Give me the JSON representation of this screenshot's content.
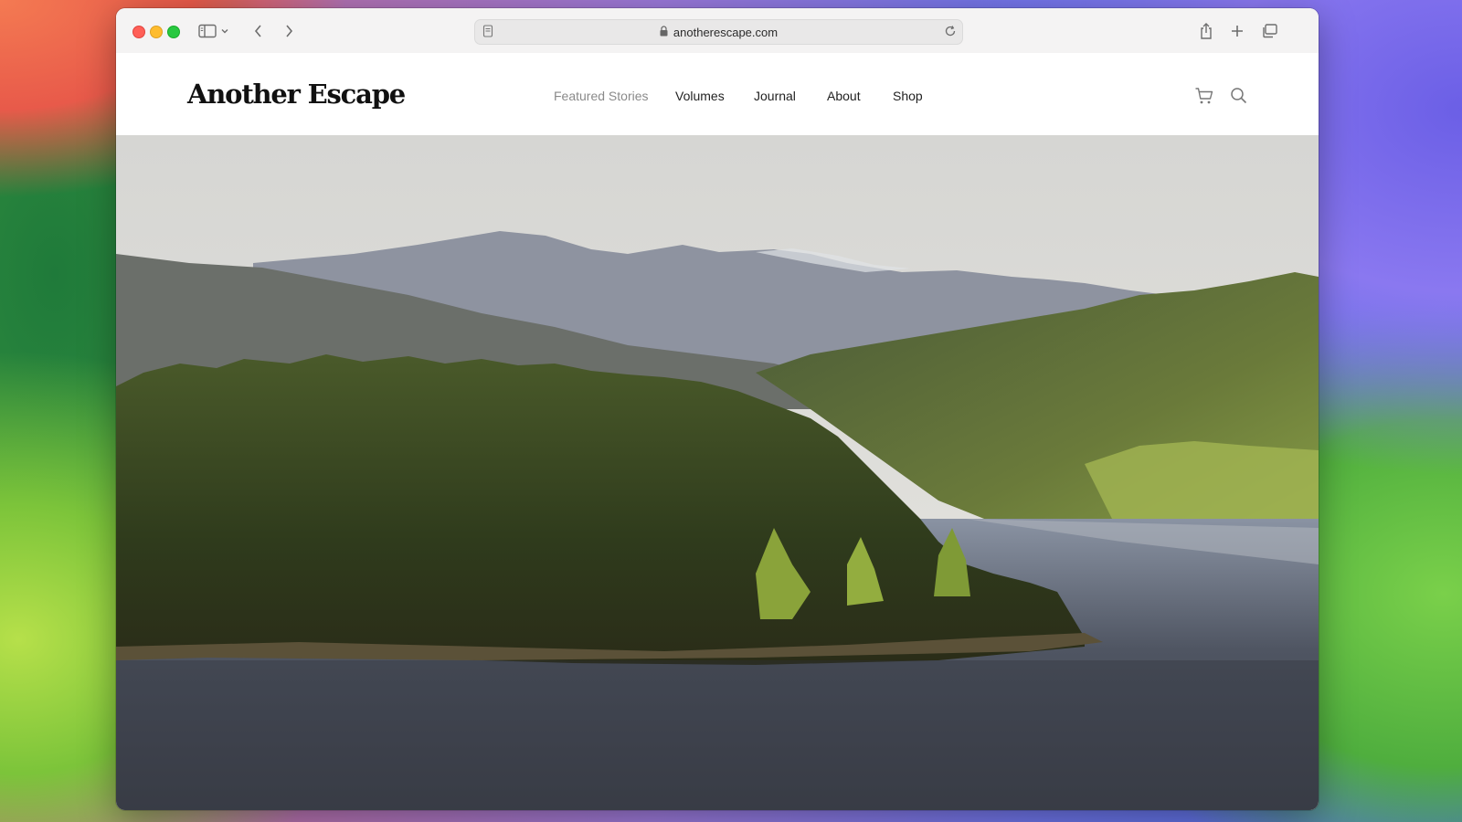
{
  "browser": {
    "url": "anotherescape.com",
    "icons": {
      "sidebar": "sidebar-icon",
      "sidebar_menu": "chevron-down-icon",
      "back": "chevron-left-icon",
      "forward": "chevron-right-icon",
      "page": "page-icon",
      "lock": "lock-icon",
      "reload": "reload-icon",
      "share": "share-icon",
      "new_tab": "plus-icon",
      "tabs": "tabs-overview-icon"
    }
  },
  "site": {
    "logo": "Another Escape",
    "nav": [
      "Featured Stories",
      "Volumes",
      "Journal",
      "About",
      "Shop"
    ],
    "header_icons": [
      "cart-icon",
      "search-icon"
    ]
  },
  "hero": {
    "image": "lake-forest-mountains-photo"
  }
}
